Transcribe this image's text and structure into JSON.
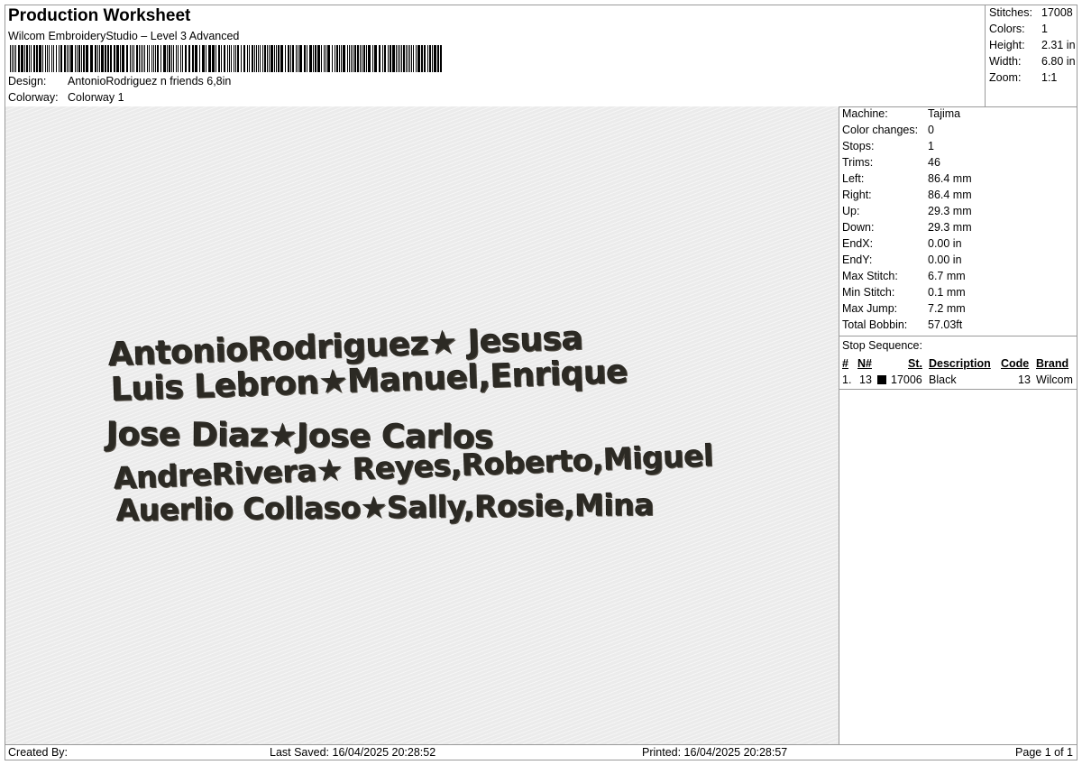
{
  "header": {
    "title": "Production Worksheet",
    "subtitle": "Wilcom EmbroideryStudio – Level 3 Advanced",
    "design_label": "Design:",
    "design_value": "AntonioRodriguez n friends 6,8in",
    "colorway_label": "Colorway:",
    "colorway_value": "Colorway 1"
  },
  "summary": {
    "stitches_label": "Stitches:",
    "stitches_value": "17008",
    "colors_label": "Colors:",
    "colors_value": "1",
    "height_label": "Height:",
    "height_value": "2.31 in",
    "width_label": "Width:",
    "width_value": "6.80 in",
    "zoom_label": "Zoom:",
    "zoom_value": "1:1"
  },
  "design": {
    "lines": [
      "AntonioRodriguez★ Jesusa",
      "Luis Lebron★Manuel,Enrique",
      "Jose Diaz★Jose Carlos",
      "AndreRivera★ Reyes,Roberto,Miguel",
      "Auerlio Collaso★Sally,Rosie,Mina"
    ],
    "thread_color": "#2c2a24"
  },
  "machine": {
    "machine_label": "Machine:",
    "machine_value": "Tajima",
    "color_changes_label": "Color changes:",
    "color_changes_value": "0",
    "stops_label": "Stops:",
    "stops_value": "1",
    "trims_label": "Trims:",
    "trims_value": "46",
    "left_label": "Left:",
    "left_value": "86.4 mm",
    "right_label": "Right:",
    "right_value": "86.4 mm",
    "up_label": "Up:",
    "up_value": "29.3 mm",
    "down_label": "Down:",
    "down_value": "29.3 mm",
    "endx_label": "EndX:",
    "endx_value": "0.00 in",
    "endy_label": "EndY:",
    "endy_value": "0.00 in",
    "max_stitch_label": "Max Stitch:",
    "max_stitch_value": "6.7 mm",
    "min_stitch_label": "Min Stitch:",
    "min_stitch_value": "0.1 mm",
    "max_jump_label": "Max Jump:",
    "max_jump_value": "7.2 mm",
    "total_bobbin_label": "Total Bobbin:",
    "total_bobbin_value": "57.03ft"
  },
  "stop_sequence": {
    "title": "Stop Sequence:",
    "columns": [
      "#",
      "N#",
      "St.",
      "Description",
      "Code",
      "Brand"
    ],
    "rows": [
      {
        "index": "1.",
        "n": "13",
        "st": "17006",
        "description": "Black",
        "code": "13",
        "brand": "Wilcom",
        "swatch_color": "#000000"
      }
    ]
  },
  "footer": {
    "created_by": "Created By:",
    "last_saved": "Last Saved: 16/04/2025 20:28:52",
    "printed": "Printed: 16/04/2025 20:28:57",
    "page": "Page 1 of 1"
  }
}
